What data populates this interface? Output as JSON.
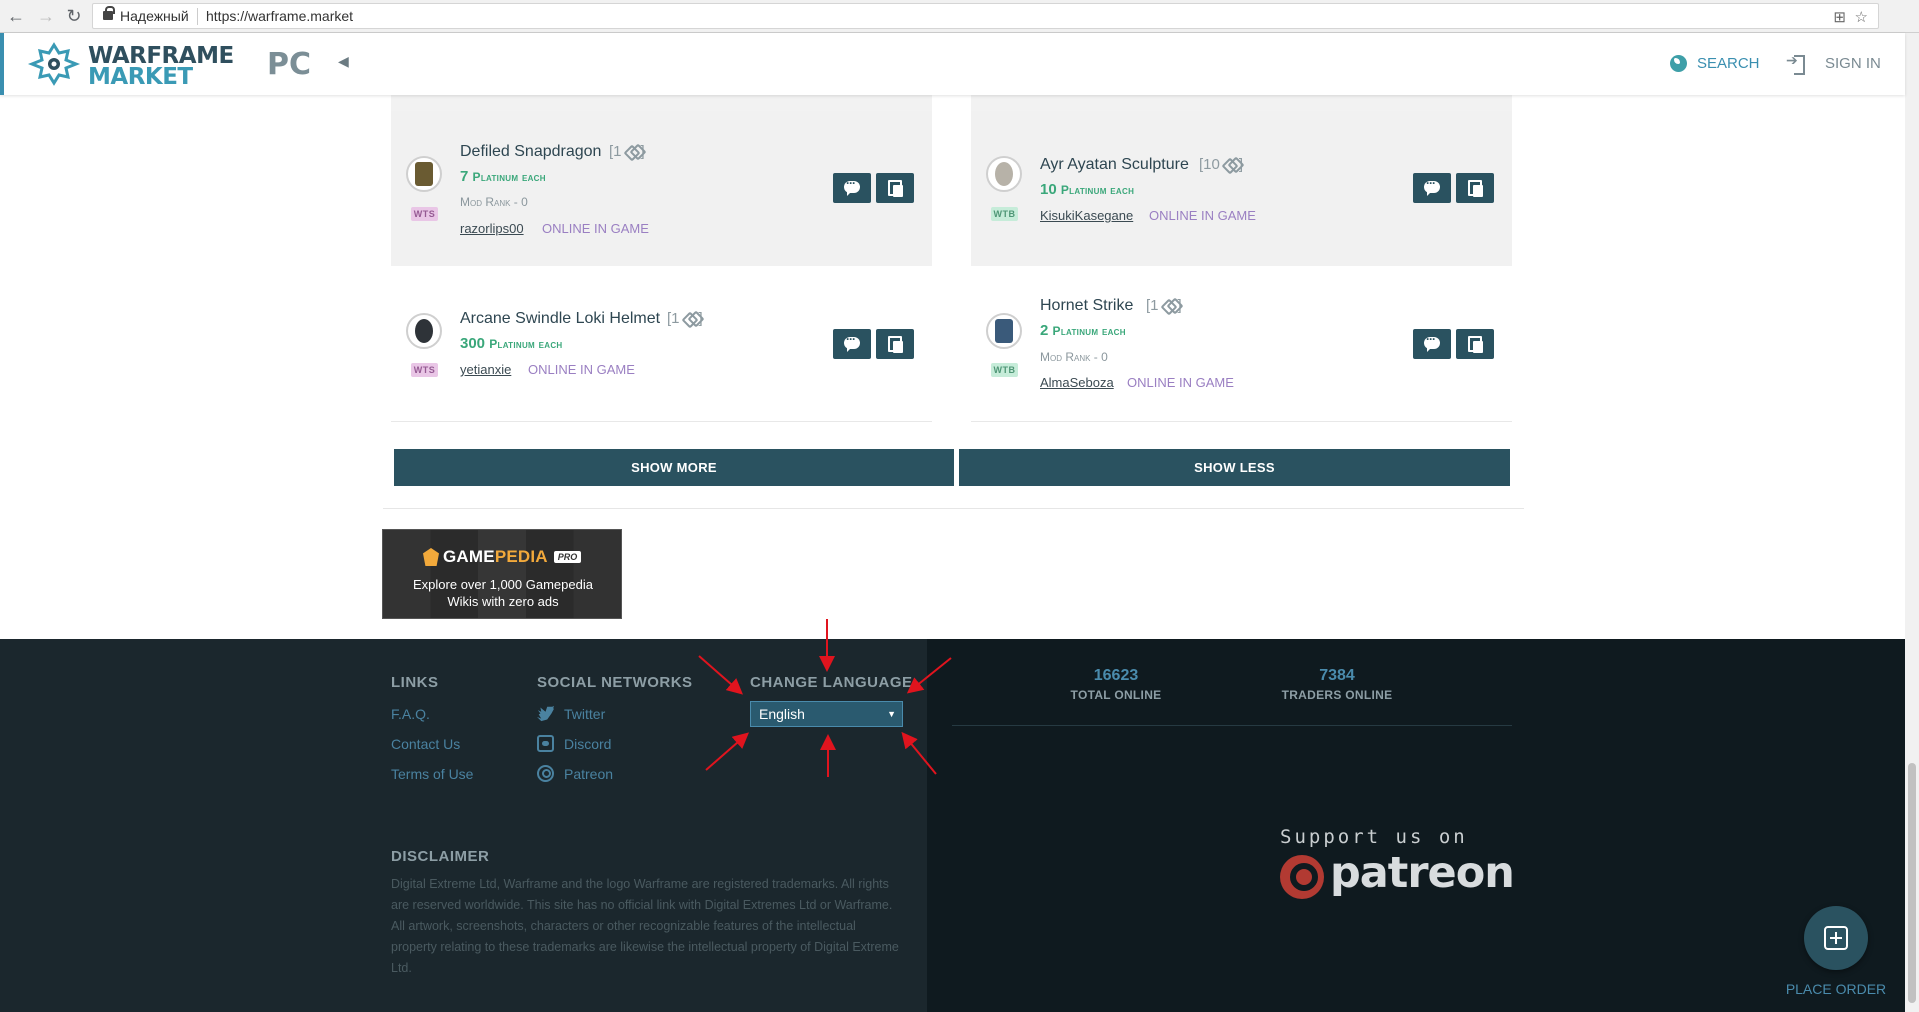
{
  "browser": {
    "secure_label": "Надежный",
    "url": "https://warframe.market"
  },
  "header": {
    "logo_line1": "WARFRAME",
    "logo_line2": "MARKET",
    "platform": "PC",
    "search_label": "SEARCH",
    "signin_label": "SIGN IN",
    "accent_color": "#3a8fb0"
  },
  "orders": [
    {
      "item": "Defiled Snapdragon",
      "quantity": "[1",
      "price": "7",
      "price_unit": "Platinum each",
      "mod_rank": "Mod Rank - 0",
      "type": "WTS",
      "user": "razorlips00",
      "status": "ONLINE IN GAME"
    },
    {
      "item": "Ayr Ayatan Sculpture",
      "quantity": "[10",
      "price": "10",
      "price_unit": "Platinum each",
      "type": "WTB",
      "user": "KisukiKasegane",
      "status": "ONLINE IN GAME"
    },
    {
      "item": "Arcane Swindle Loki Helmet",
      "quantity": "[1",
      "price": "300",
      "price_unit": "Platinum each",
      "type": "WTS",
      "user": "yetianxie",
      "status": "ONLINE IN GAME"
    },
    {
      "item": "Hornet Strike",
      "quantity": "[1",
      "price": "2",
      "price_unit": "Platinum each",
      "mod_rank": "Mod Rank - 0",
      "type": "WTB",
      "user": "AlmaSeboza",
      "status": "ONLINE IN GAME"
    }
  ],
  "buttons": {
    "show_more": "SHOW MORE",
    "show_less": "SHOW LESS"
  },
  "ad": {
    "brand_a": "GAME",
    "brand_b": "PEDIA",
    "brand_pro": "PRO",
    "line1": "Explore over 1,000 Gamepedia",
    "line2": "Wikis with zero ads"
  },
  "footer": {
    "links_heading": "LINKS",
    "links": [
      "F.A.Q.",
      "Contact Us",
      "Terms of Use"
    ],
    "social_heading": "SOCIAL NETWORKS",
    "social": [
      "Twitter",
      "Discord",
      "Patreon"
    ],
    "language_heading": "CHANGE LANGUAGE",
    "language_selected": "English",
    "disclaimer_heading": "DISCLAIMER",
    "disclaimer_text": "Digital Extreme Ltd, Warframe and the logo Warframe are registered trademarks. All rights are reserved worldwide. This site has no official link with Digital Extremes Ltd or Warframe. All artwork, screenshots, characters or other recognizable features of the intellectual property relating to these trademarks are likewise the intellectual property of Digital Extreme Ltd.",
    "total_online": "16623",
    "total_online_label": "TOTAL ONLINE",
    "traders_online": "7384",
    "traders_online_label": "TRADERS ONLINE",
    "support_text": "Support us on",
    "patreon_word": "patreon",
    "place_order": "PLACE ORDER"
  },
  "annotation_color": "#e0141e"
}
